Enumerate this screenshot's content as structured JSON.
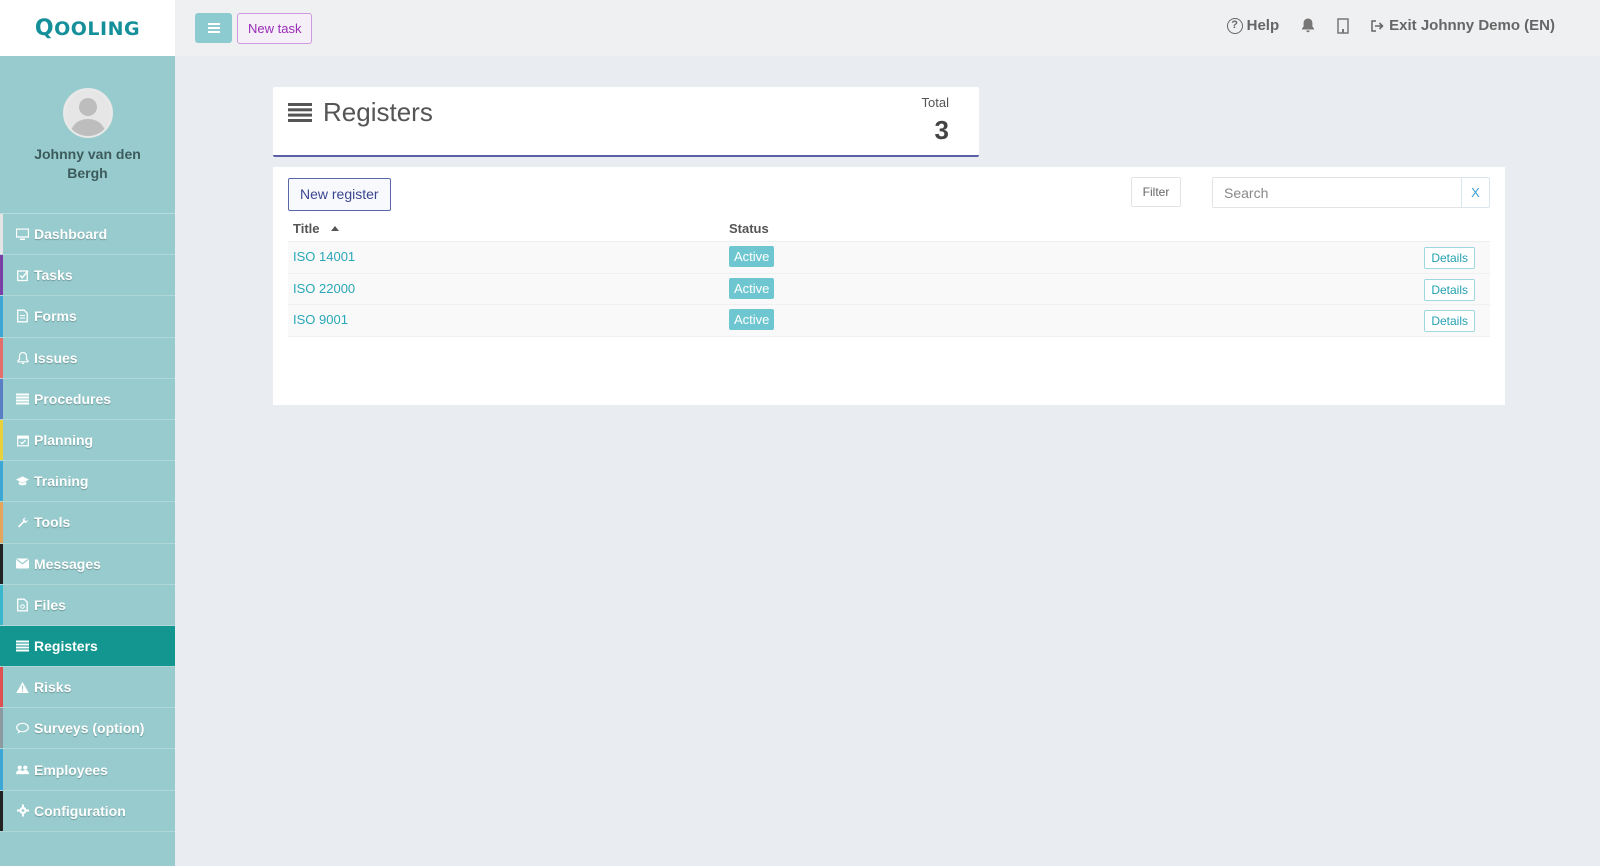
{
  "logo": {
    "text_q": "Q",
    "text_rest": "OOLING"
  },
  "topbar": {
    "new_task_label": "New task",
    "help_label": "Help",
    "exit_label": "Exit Johnny Demo (EN)"
  },
  "sidebar": {
    "username": "Johnny van den Bergh",
    "items": [
      {
        "label": "Dashboard",
        "icon": "monitor-icon",
        "color": "#e5e5e5"
      },
      {
        "label": "Tasks",
        "icon": "checkbox-icon",
        "color": "#7b3ea6"
      },
      {
        "label": "Forms",
        "icon": "document-icon",
        "color": "#3aa7d6"
      },
      {
        "label": "Issues",
        "icon": "bell-icon",
        "color": "#e56e6a"
      },
      {
        "label": "Procedures",
        "icon": "list-icon",
        "color": "#5a7ec4"
      },
      {
        "label": "Planning",
        "icon": "calendar-icon",
        "color": "#e8d13a"
      },
      {
        "label": "Training",
        "icon": "graduation-cap-icon",
        "color": "#3aa7d6"
      },
      {
        "label": "Tools",
        "icon": "wrench-icon",
        "color": "#e5a55a"
      },
      {
        "label": "Messages",
        "icon": "envelope-icon",
        "color": "#222222"
      },
      {
        "label": "Files",
        "icon": "file-icon",
        "color": "#3ab7cc"
      },
      {
        "label": "Registers",
        "icon": "list-icon",
        "color": "#139690"
      },
      {
        "label": "Risks",
        "icon": "warning-icon",
        "color": "#e05050"
      },
      {
        "label": "Surveys (option)",
        "icon": "comment-icon",
        "color": "#8a9aa0"
      },
      {
        "label": "Employees",
        "icon": "users-icon",
        "color": "#3aa7d6"
      },
      {
        "label": "Configuration",
        "icon": "gear-icon",
        "color": "#222222"
      }
    ],
    "active_index": 10
  },
  "header": {
    "title": "Registers",
    "total_label": "Total",
    "total_value": "3"
  },
  "panel": {
    "new_register_label": "New register",
    "filter_label": "Filter",
    "search_placeholder": "Search",
    "clear_label": "X",
    "columns": {
      "title": "Title",
      "status": "Status"
    },
    "rows": [
      {
        "title": "ISO 14001",
        "status": "Active",
        "action": "Details"
      },
      {
        "title": "ISO 22000",
        "status": "Active",
        "action": "Details"
      },
      {
        "title": "ISO 9001",
        "status": "Active",
        "action": "Details"
      }
    ]
  },
  "colors": {
    "accent": "#139690",
    "sidebar_bg": "#97cbcd",
    "link": "#2aa7b8",
    "badge": "#6ec6d0",
    "header_underline": "#5b5ea6"
  }
}
